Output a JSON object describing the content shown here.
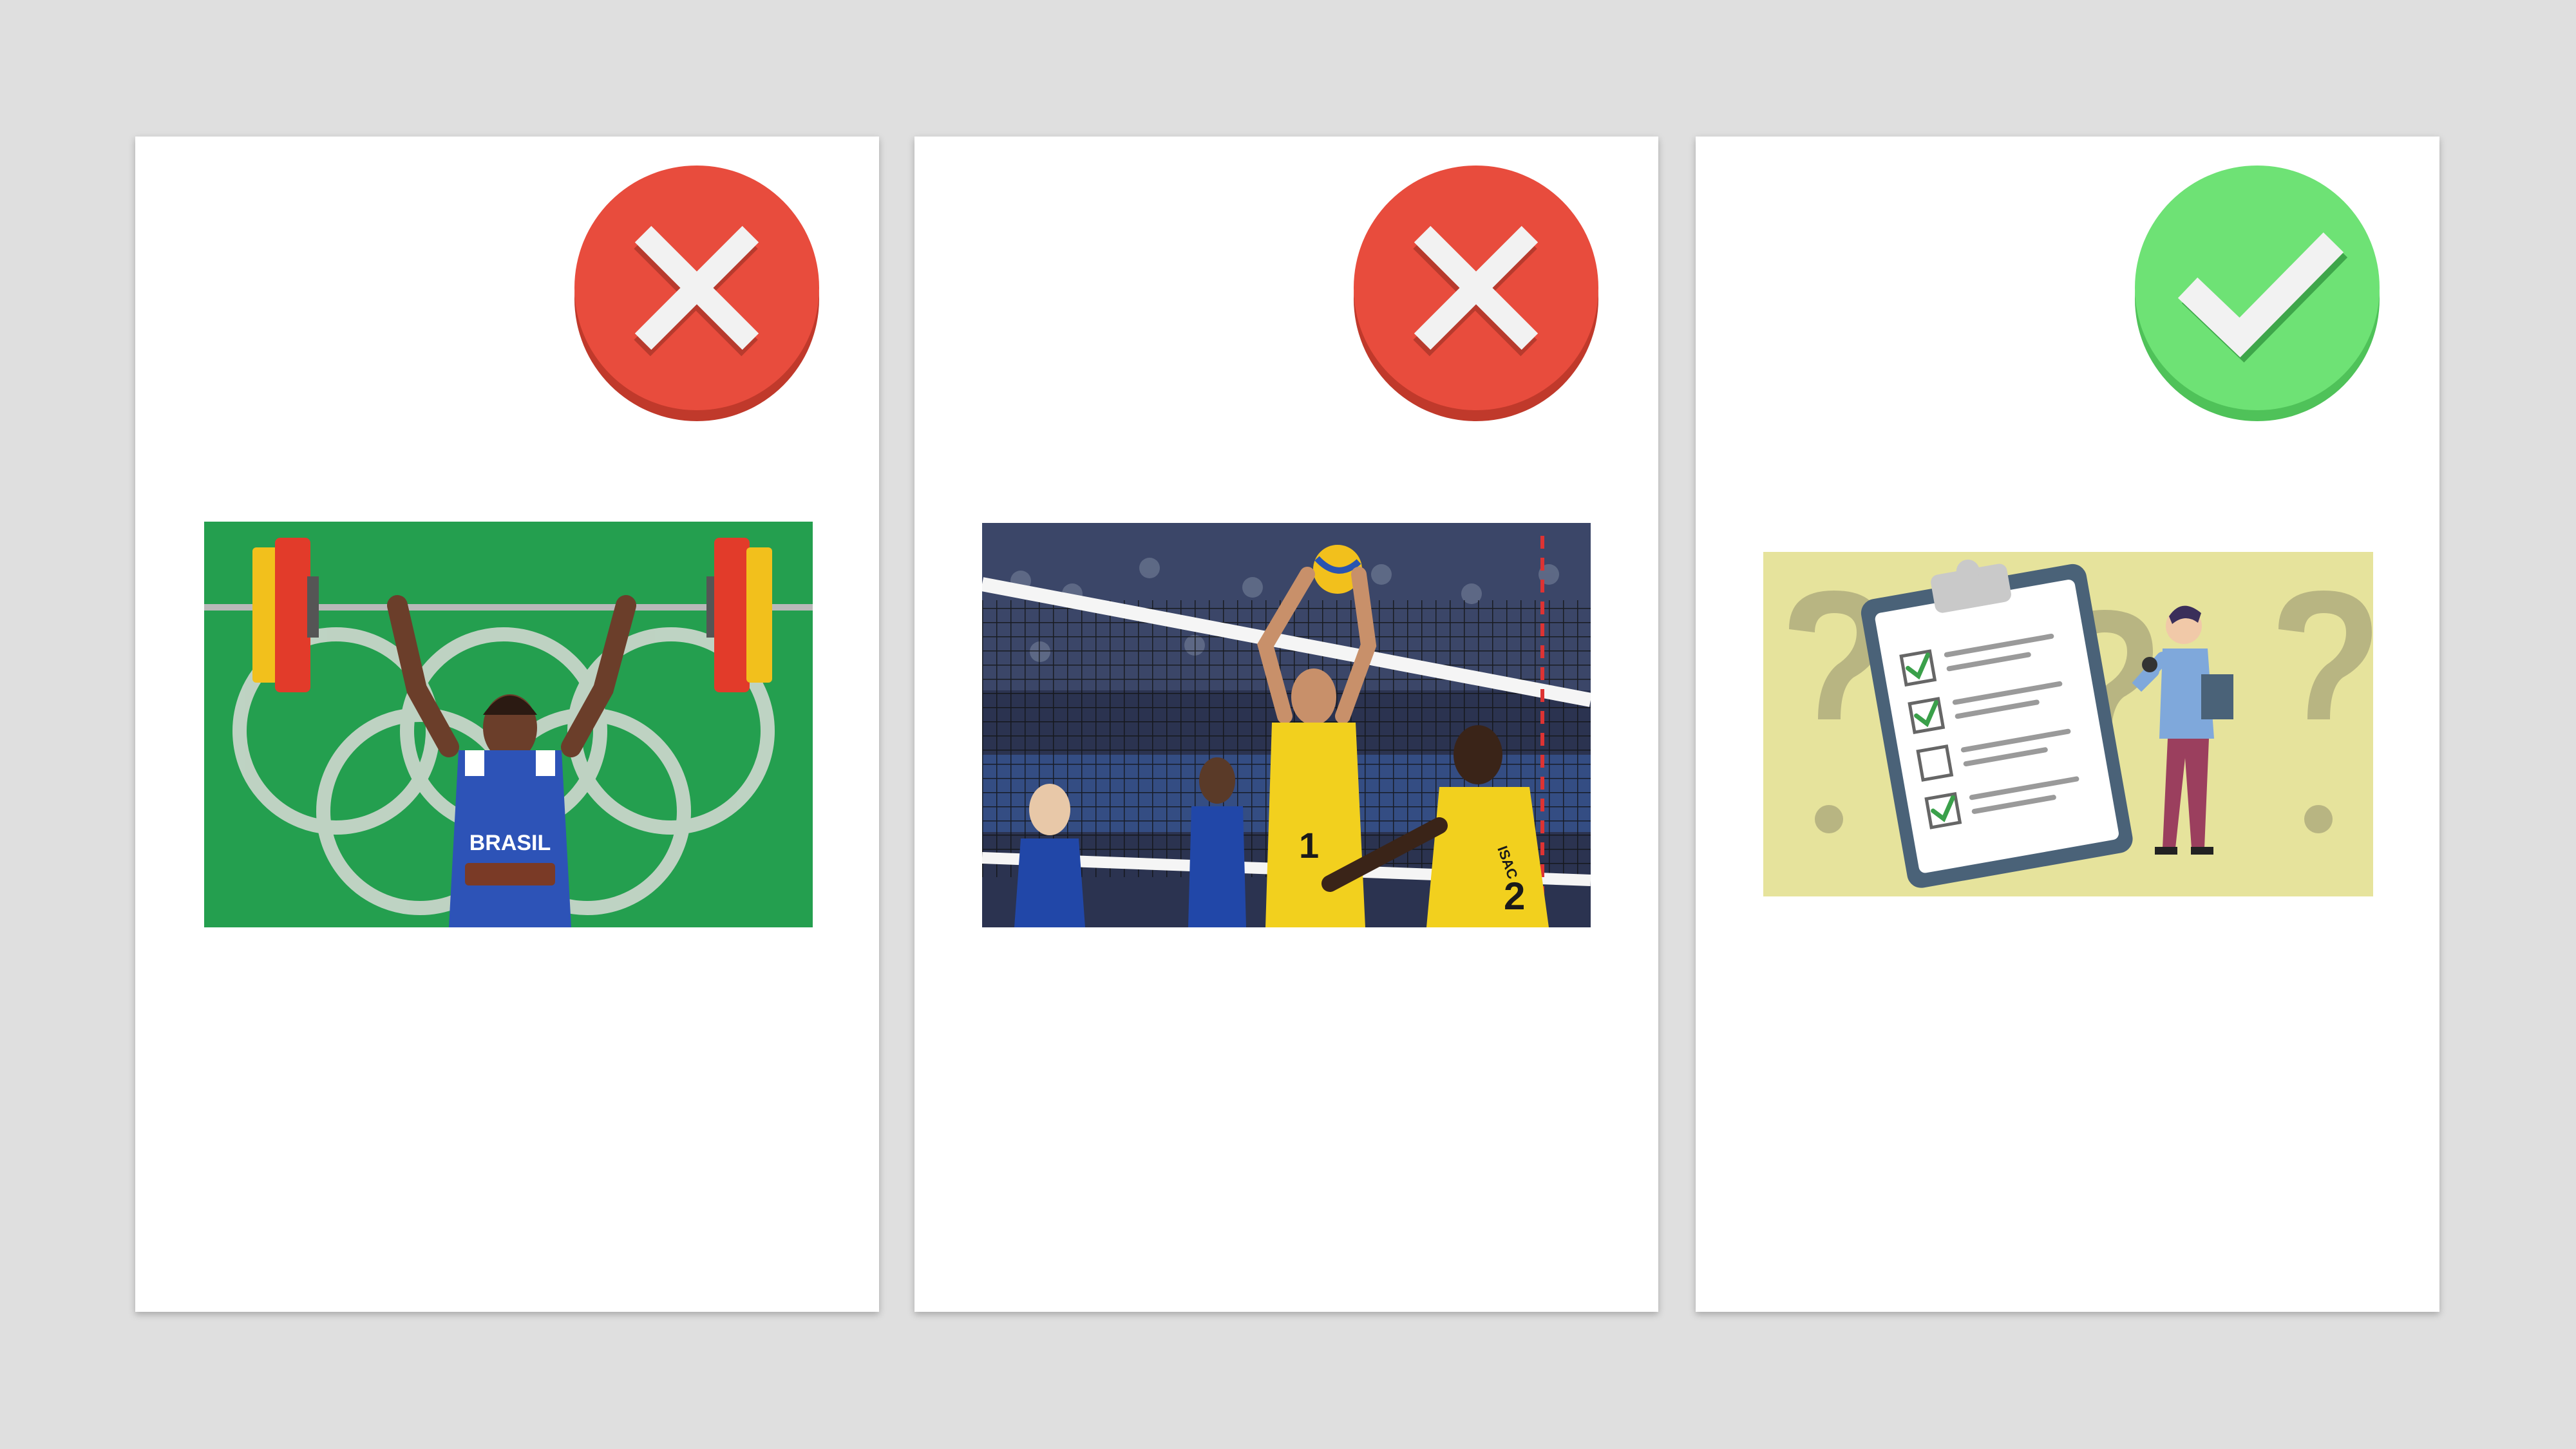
{
  "cards": [
    {
      "status": "incorrect",
      "badge_icon": "close-icon",
      "badge_color": "#e84c3d",
      "image": "weightlifting-photo",
      "jersey_text": "BRASIL"
    },
    {
      "status": "incorrect",
      "badge_icon": "close-icon",
      "badge_color": "#e84c3d",
      "image": "volleyball-photo",
      "jersey_numbers": [
        "1",
        "2"
      ],
      "jersey_name": "ISAC"
    },
    {
      "status": "correct",
      "badge_icon": "check-icon",
      "badge_color": "#6ee275",
      "image": "survey-checklist-illustration"
    }
  ],
  "colors": {
    "background": "#dfdfdf",
    "card": "#ffffff",
    "incorrect": "#e84c3d",
    "correct": "#6ee275"
  }
}
